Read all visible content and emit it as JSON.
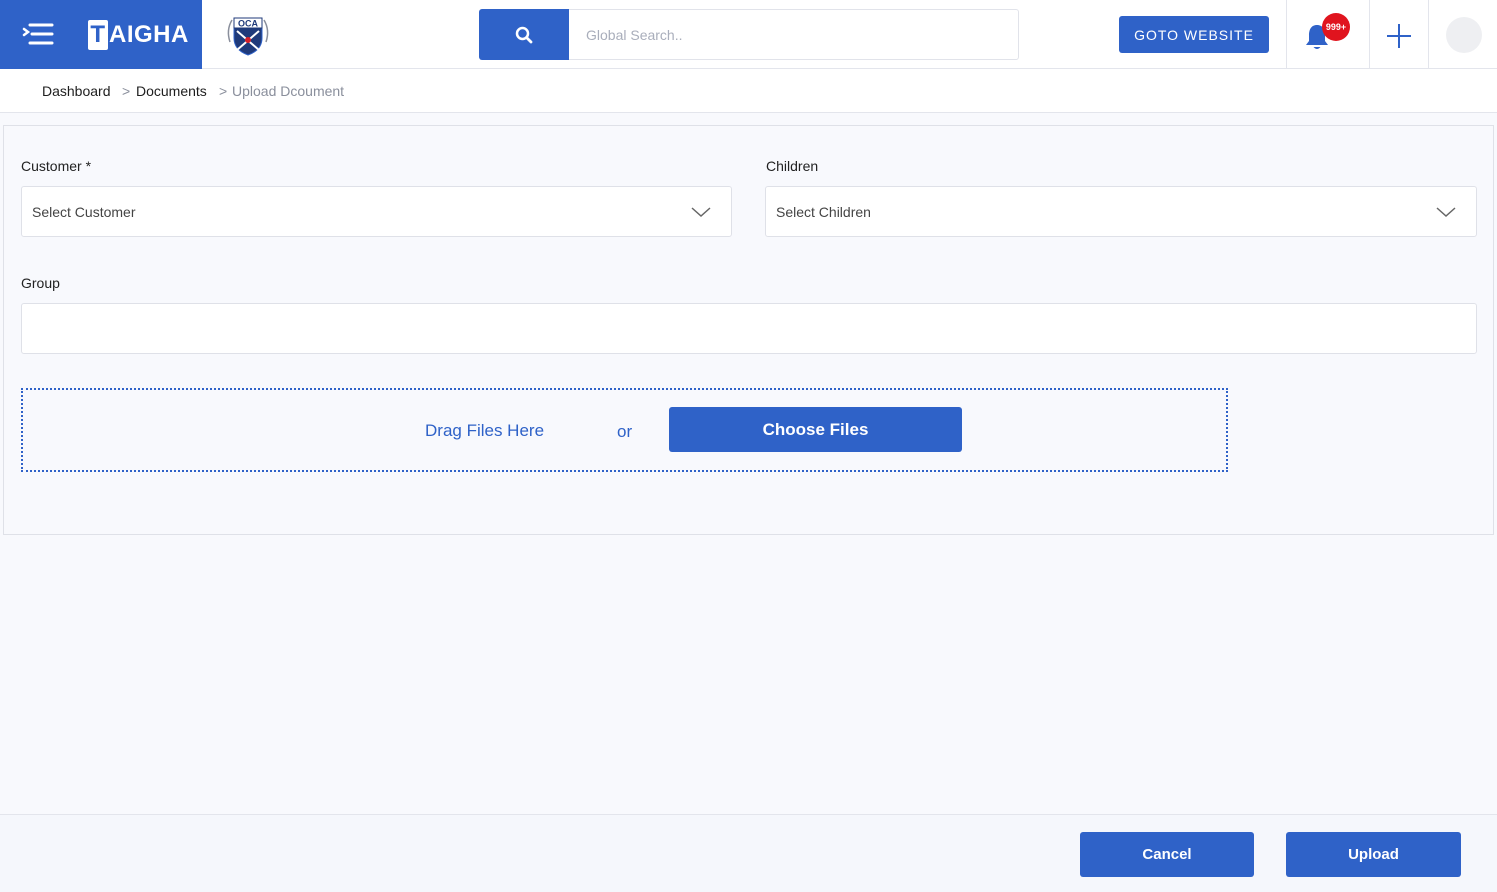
{
  "header": {
    "brand_name": "AIGHA",
    "brand_initial": "T",
    "school_logo_text": "OCA",
    "search_placeholder": "Global Search..",
    "goto_label": "GOTO WEBSITE",
    "notification_count": "999+",
    "icons": {
      "menu": "menu-icon",
      "search": "search-icon",
      "bell": "bell-icon",
      "plus": "plus-icon"
    },
    "accent_color": "#2f62c8"
  },
  "breadcrumb": {
    "items": [
      "Dashboard",
      "Documents",
      "Upload Dcoument"
    ],
    "separator": ">"
  },
  "form": {
    "customer_label": "Customer *",
    "customer_placeholder": "Select Customer",
    "children_label": "Children",
    "children_placeholder": "Select Children",
    "group_label": "Group",
    "group_value": "",
    "drag_text": "Drag Files Here",
    "or_text": "or",
    "choose_label": "Choose Files"
  },
  "footer": {
    "cancel_label": "Cancel",
    "upload_label": "Upload"
  }
}
